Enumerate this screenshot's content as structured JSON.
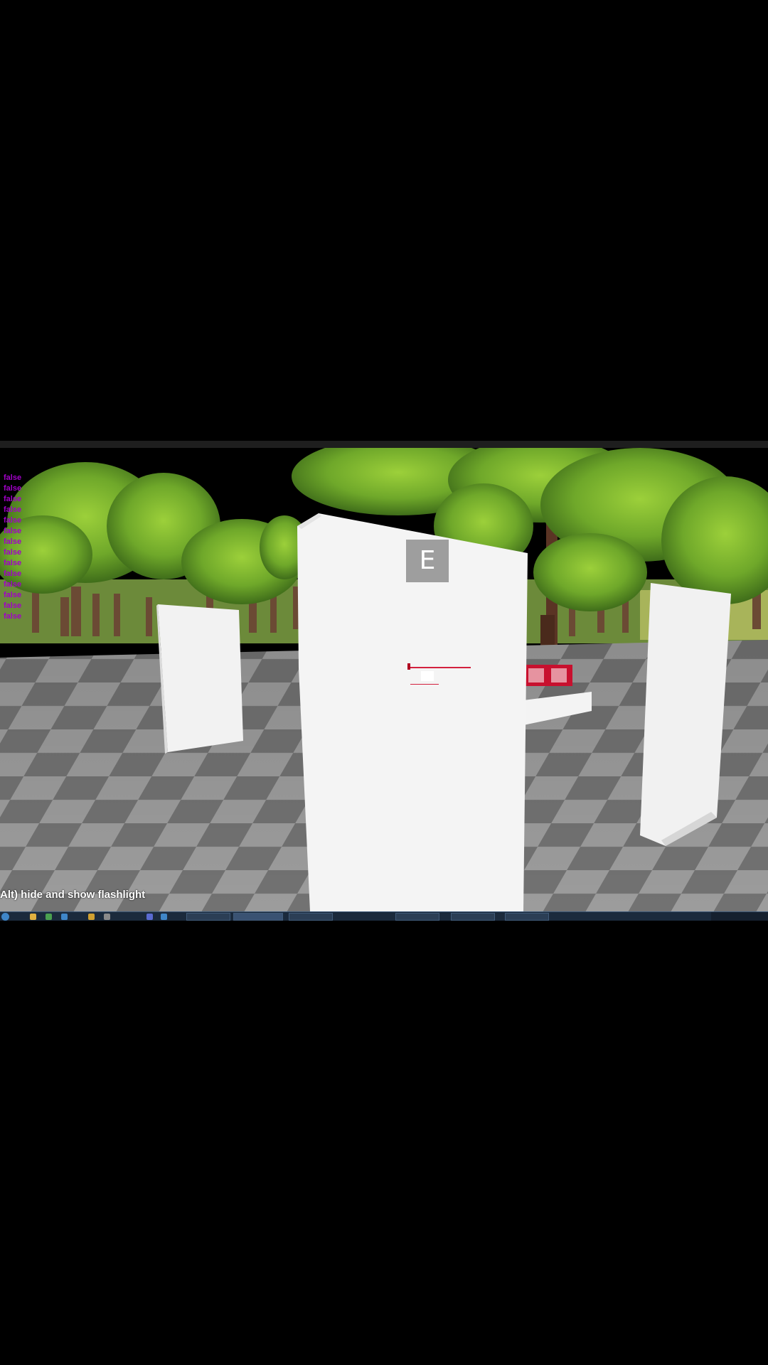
{
  "window": {
    "title": ""
  },
  "hud": {
    "debug_log": [
      "false",
      "false",
      "false",
      "false",
      "false",
      "false",
      "false",
      "false",
      "false",
      "false",
      "false",
      "false",
      "false",
      "false"
    ],
    "interact_key": "E",
    "small_label": "",
    "hint": "Alt) hide and show flashlight"
  },
  "colors": {
    "debug_text": "#a100c8",
    "sky": "#000000",
    "foliage": "#7fb531",
    "floor_light": "#9a9a9a",
    "floor_dark": "#6f6f6f",
    "pillar": "#f3f3f3",
    "crosshair": "#d3203e",
    "prop_box": "#c8102e"
  },
  "taskbar": {
    "icons": [
      "start-icon",
      "explorer-icon",
      "media-icon",
      "browser-icon",
      "folder-icon",
      "settings-icon",
      "chat-icon",
      "store-icon"
    ]
  }
}
